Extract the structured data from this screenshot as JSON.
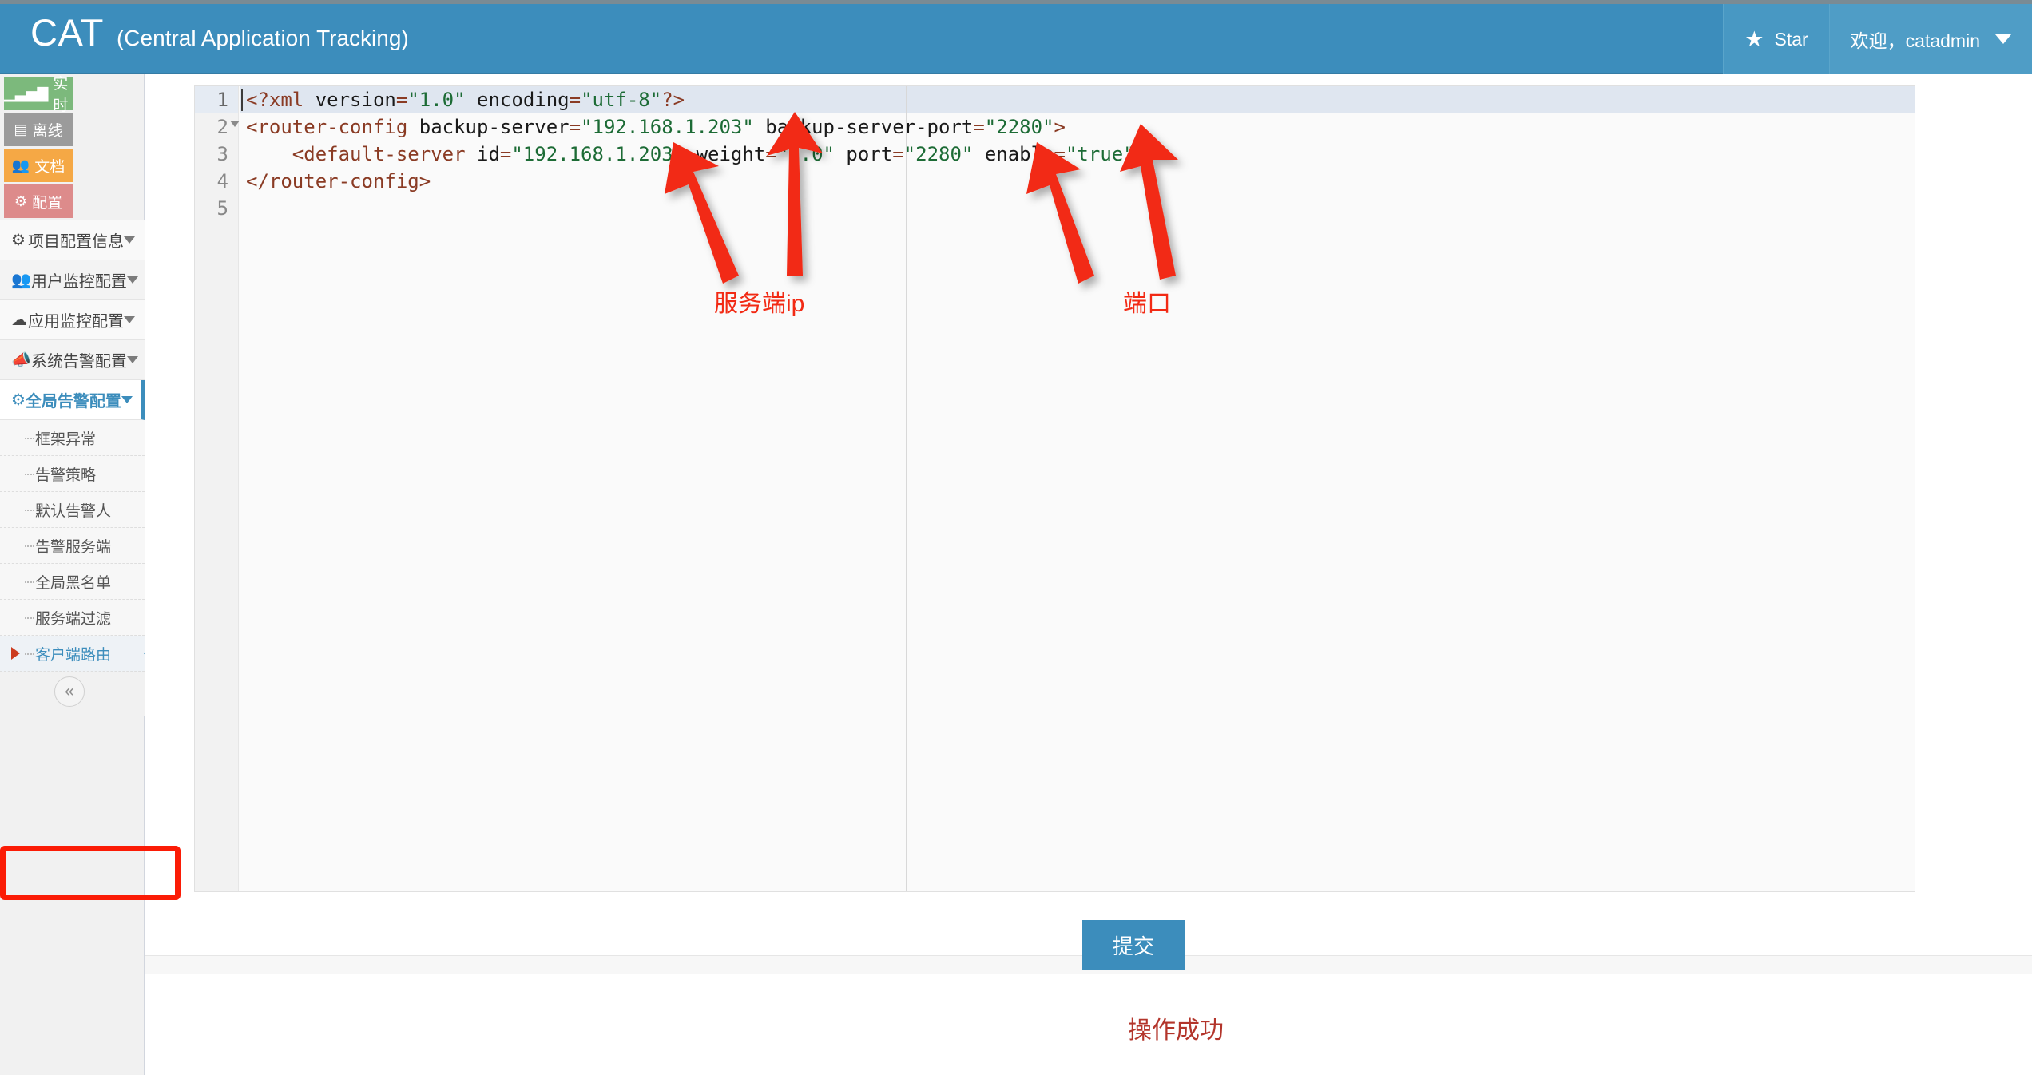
{
  "header": {
    "brand_main": "CAT",
    "brand_sub": "(Central Application Tracking)",
    "star_icon": "star-icon",
    "star_label": "Star",
    "user_label": "欢迎，catadmin"
  },
  "sidebar": {
    "quick_buttons": [
      {
        "label": "实时",
        "icon": "bar-chart-icon",
        "color": "#7cb97c"
      },
      {
        "label": "离线",
        "icon": "film-icon",
        "color": "#9b9b9b"
      },
      {
        "label": "文档",
        "icon": "users-icon",
        "color": "#f5a845"
      },
      {
        "label": "配置",
        "icon": "gears-icon",
        "color": "#dd8b8b"
      }
    ],
    "nav_items": [
      {
        "label": "项目配置信息",
        "icon": "gears-icon",
        "active": false
      },
      {
        "label": "用户监控配置",
        "icon": "users-icon",
        "active": false
      },
      {
        "label": "应用监控配置",
        "icon": "cloud-icon",
        "active": false
      },
      {
        "label": "系统告警配置",
        "icon": "megaphone-icon",
        "active": false
      },
      {
        "label": "全局告警配置",
        "icon": "cog-icon",
        "active": true
      }
    ],
    "sub_items": [
      {
        "label": "框架异常",
        "selected": false
      },
      {
        "label": "告警策略",
        "selected": false
      },
      {
        "label": "默认告警人",
        "selected": false
      },
      {
        "label": "告警服务端",
        "selected": false
      },
      {
        "label": "全局黑名单",
        "selected": false
      },
      {
        "label": "服务端过滤",
        "selected": false
      },
      {
        "label": "客户端路由",
        "selected": true
      }
    ],
    "collapse_icon": "«"
  },
  "editor": {
    "line_numbers": [
      "1",
      "2",
      "3",
      "4",
      "5"
    ],
    "lines": [
      "<?xml version=\"1.0\" encoding=\"utf-8\"?>",
      "<router-config backup-server=\"192.168.1.203\" backup-server-port=\"2280\">",
      "    <default-server id=\"192.168.1.203\" weight=\"1.0\" port=\"2280\" enable=\"true\"/>",
      "</router-config>",
      ""
    ],
    "values": {
      "backup_server": "192.168.1.203",
      "backup_server_port": "2280",
      "default_server_id": "192.168.1.203",
      "weight": "1.0",
      "port": "2280",
      "enable": "true",
      "xml_version": "1.0",
      "encoding": "utf-8"
    }
  },
  "annotations": [
    {
      "label": "服务端ip",
      "color": "#f22a14"
    },
    {
      "label": "端口",
      "color": "#f22a14"
    }
  ],
  "footer": {
    "submit_label": "提交",
    "result_message": "操作成功",
    "result_color": "#b3352b"
  }
}
